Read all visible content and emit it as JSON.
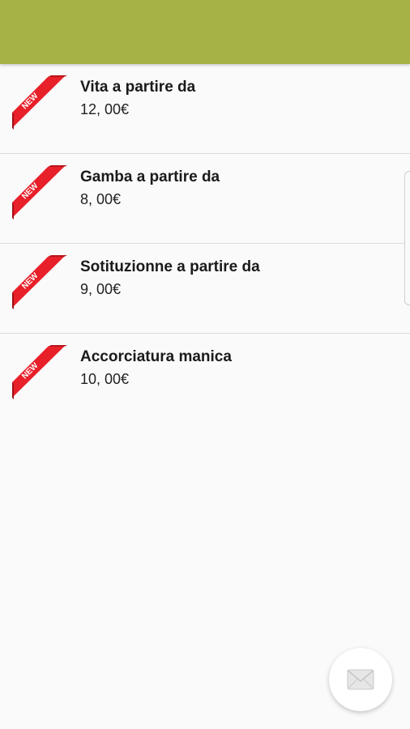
{
  "colors": {
    "app_bar": "#a6b245",
    "badge_red": "#e8202a",
    "background": "#fafafa"
  },
  "badge": {
    "label": "NEW",
    "icon": "new-ribbon-icon"
  },
  "items": [
    {
      "title": "Vita a partire da",
      "price": "12, 00€"
    },
    {
      "title": "Gamba a partire da",
      "price": "8, 00€"
    },
    {
      "title": "Sotituzionne a partire da",
      "price": "9, 00€"
    },
    {
      "title": "Accorciatura manica",
      "price": "10, 00€"
    }
  ],
  "fab": {
    "icon": "mail-icon"
  }
}
